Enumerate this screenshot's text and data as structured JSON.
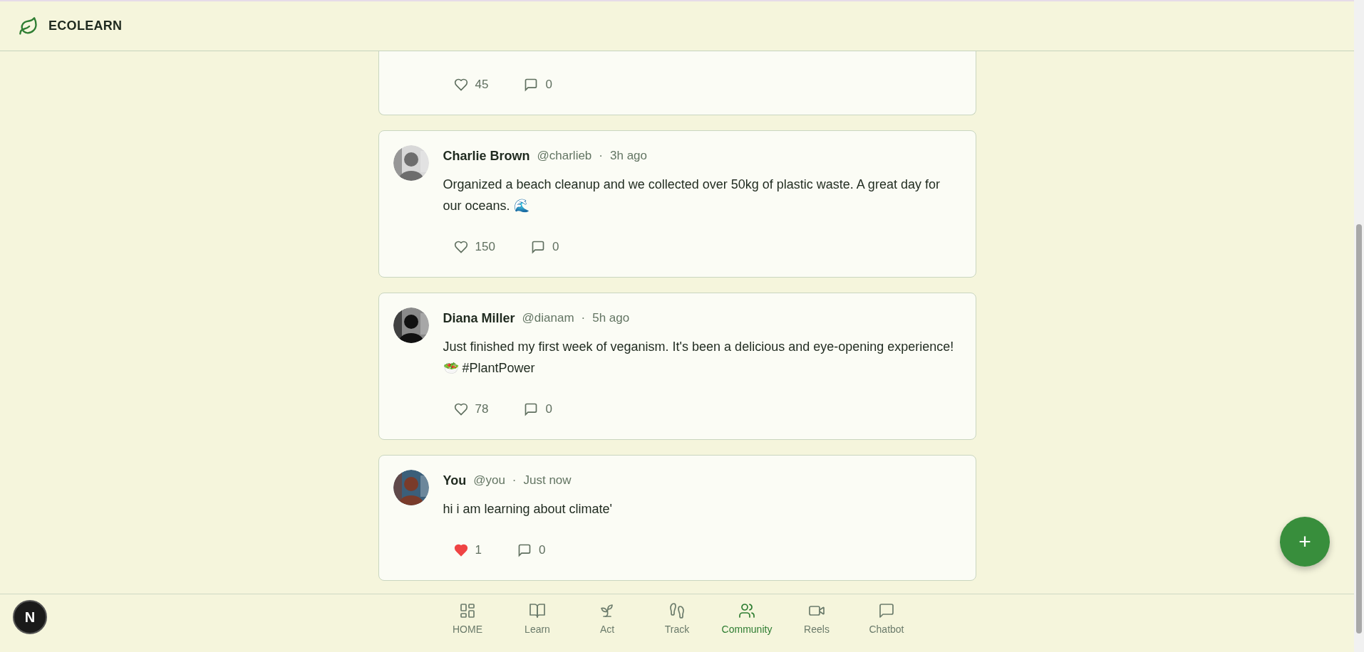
{
  "header": {
    "logo_text": "ECOLEARN"
  },
  "partial_post": {
    "likes": "45",
    "comments": "0",
    "liked": false
  },
  "posts": [
    {
      "name": "Charlie Brown",
      "handle": "@charlieb",
      "separator": "·",
      "time": "3h ago",
      "text": "Organized a beach cleanup and we collected over 50kg of plastic waste. A great day for our oceans. 🌊",
      "likes": "150",
      "comments": "0",
      "liked": false
    },
    {
      "name": "Diana Miller",
      "handle": "@dianam",
      "separator": "·",
      "time": "5h ago",
      "text": "Just finished my first week of veganism. It's been a delicious and eye-opening experience! 🥗 #PlantPower",
      "likes": "78",
      "comments": "0",
      "liked": false
    },
    {
      "name": "You",
      "handle": "@you",
      "separator": "·",
      "time": "Just now",
      "text": "hi i am learning about climate'",
      "likes": "1",
      "comments": "0",
      "liked": true
    }
  ],
  "fab": {
    "label": "+"
  },
  "dev_badge": {
    "label": "N"
  },
  "nav": [
    {
      "kind": "home",
      "label": "HOME",
      "selected": false
    },
    {
      "kind": "learn",
      "label": "Learn",
      "selected": false
    },
    {
      "kind": "act",
      "label": "Act",
      "selected": false
    },
    {
      "kind": "track",
      "label": "Track",
      "selected": false
    },
    {
      "kind": "community",
      "label": "Community",
      "selected": true
    },
    {
      "kind": "reels",
      "label": "Reels",
      "selected": false
    },
    {
      "kind": "chatbot",
      "label": "Chatbot",
      "selected": false
    }
  ]
}
